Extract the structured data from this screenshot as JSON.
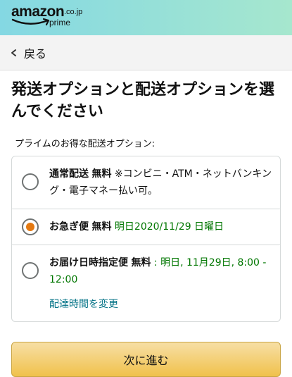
{
  "header": {
    "logo_word": "amazon",
    "logo_tld": ".co.jp",
    "logo_prime": "prime"
  },
  "backbar": {
    "label": "戻る"
  },
  "page": {
    "title": "発送オプションと配送オプションを選んでください",
    "section_label": "プライムのお得な配送オプション:"
  },
  "options": [
    {
      "name": "通常配送",
      "price": "無料",
      "note": "※コンビニ・ATM・ネットバンキング・電子マネー払い可。",
      "selected": false
    },
    {
      "name": "お急ぎ便",
      "price": "無料",
      "date": "明日2020/11/29 日曜日",
      "selected": true
    },
    {
      "name": "お届け日時指定便",
      "price": "無料",
      "date": ": 明日, 11月29日, 8:00 - 12:00",
      "link": "配達時間を変更",
      "selected": false
    }
  ],
  "buttons": {
    "continue_label": "次に進む"
  },
  "colors": {
    "accent_orange": "#e47911",
    "green": "#007600",
    "link": "#007185",
    "button_yellow": "#f0c14b"
  }
}
